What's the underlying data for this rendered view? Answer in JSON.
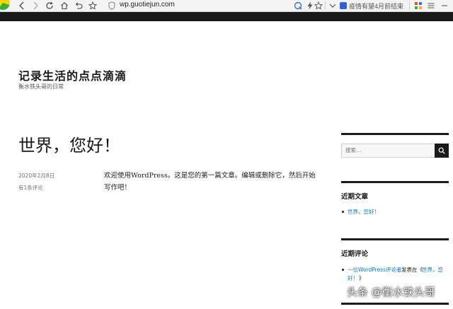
{
  "browser": {
    "url": "wp.guotiejun.com",
    "news_ticker": "疫情有望4月前结束"
  },
  "site": {
    "title": "记录生活的点点滴滴",
    "description": "衡水铁头哥的日常"
  },
  "post": {
    "title": "世界，您好！",
    "date": "2020年2月8日",
    "comments": "有1条评论",
    "body": "欢迎使用WordPress。这是您的第一篇文章。编辑或删除它，然后开始写作吧！"
  },
  "sidebar": {
    "search_placeholder": "搜索…",
    "recent_posts_title": "近期文章",
    "recent_posts": [
      "世界，您好！"
    ],
    "recent_comments_title": "近期评论",
    "comment": {
      "author": "一位WordPress评论者",
      "connector": "发表在《",
      "post_line1": "世界，您",
      "post_line2": "好！",
      "close": "》"
    }
  },
  "watermark": "头条 @衡水铁头哥"
}
